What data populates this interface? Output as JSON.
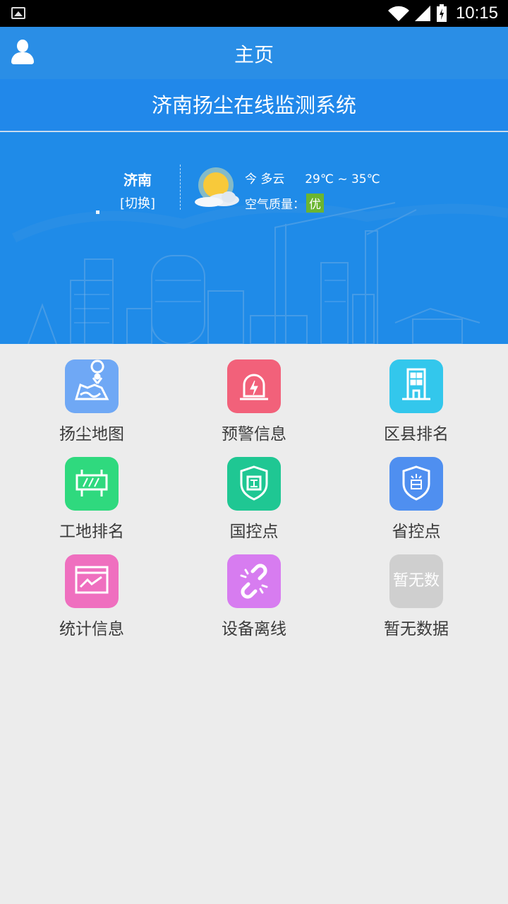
{
  "status_bar": {
    "time": "10:15"
  },
  "app_bar": {
    "title": "主页",
    "user_icon": "user-icon"
  },
  "banner": {
    "title": "济南扬尘在线监测系统"
  },
  "weather": {
    "city": "济南",
    "switch_label": "[切换]",
    "day": "今",
    "condition": "多云",
    "temperature": "29℃ ~ 35℃",
    "air_quality_label": "空气质量：",
    "air_quality_value": "优"
  },
  "menu": {
    "items": [
      {
        "label": "扬尘地图",
        "icon": "map-pin-icon",
        "color": "#6fa8f5"
      },
      {
        "label": "预警信息",
        "icon": "alarm-icon",
        "color": "#f2617a"
      },
      {
        "label": "区县排名",
        "icon": "building-icon",
        "color": "#33c7ec"
      },
      {
        "label": "工地排名",
        "icon": "construction-sign-icon",
        "color": "#2fd97e"
      },
      {
        "label": "国控点",
        "icon": "national-shield-icon",
        "color": "#1fc793"
      },
      {
        "label": "省控点",
        "icon": "province-shield-icon",
        "color": "#4f8ff0"
      },
      {
        "label": "统计信息",
        "icon": "chart-icon",
        "color": "#ef6fbf"
      },
      {
        "label": "设备离线",
        "icon": "broken-link-icon",
        "color": "#d77cf0"
      },
      {
        "label": "暂无数据",
        "icon": "no-data-icon",
        "color": "#cfcfcf",
        "icon_text": "暂无数"
      }
    ]
  }
}
